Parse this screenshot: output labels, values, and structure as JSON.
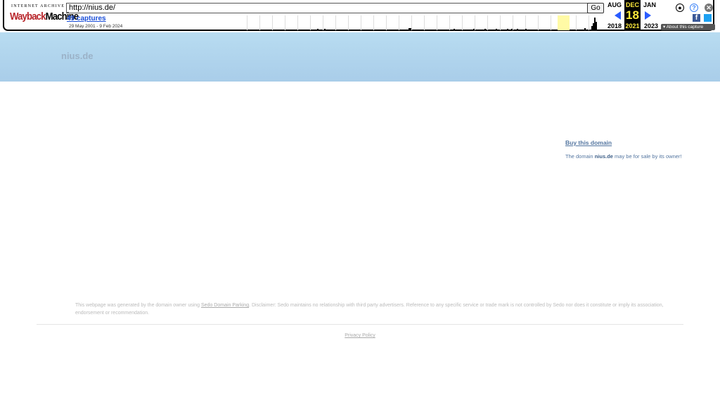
{
  "toolbar": {
    "logo_top": "INTERNET ARCHIVE",
    "logo_word_a": "Wayback",
    "logo_word_b": "Machine",
    "url": "http://nius.de/",
    "go_label": "Go",
    "captures": "49 captures",
    "date_range": "29 May 2001 - 9 Feb 2024",
    "prev_month": "AUG",
    "prev_year": "2018",
    "cur_month": "DEC",
    "cur_day": "18",
    "cur_year": "2021",
    "next_month": "JAN",
    "next_year": "2023",
    "about": "About this capture",
    "icons": [
      "user-icon",
      "help-icon",
      "close-icon",
      "facebook-icon",
      "twitter-icon"
    ],
    "accent": "#2a5cff"
  },
  "page": {
    "site_title": "nius.de",
    "buy_link": "Buy this domain",
    "sale_pre": "The domain ",
    "sale_domain": "nius.de",
    "sale_post": " may be for sale by its owner!",
    "disclaimer_a": "This webpage was generated by the domain owner using ",
    "disclaimer_link": "Sedo Domain Parking",
    "disclaimer_b": ". Disclaimer: Sedo maintains no relationship with third party advertisers. Reference to any specific service or trade mark is not controlled by Sedo nor does it constitute or imply its association, endorsement or recommendation.",
    "privacy": "Privacy Policy"
  }
}
